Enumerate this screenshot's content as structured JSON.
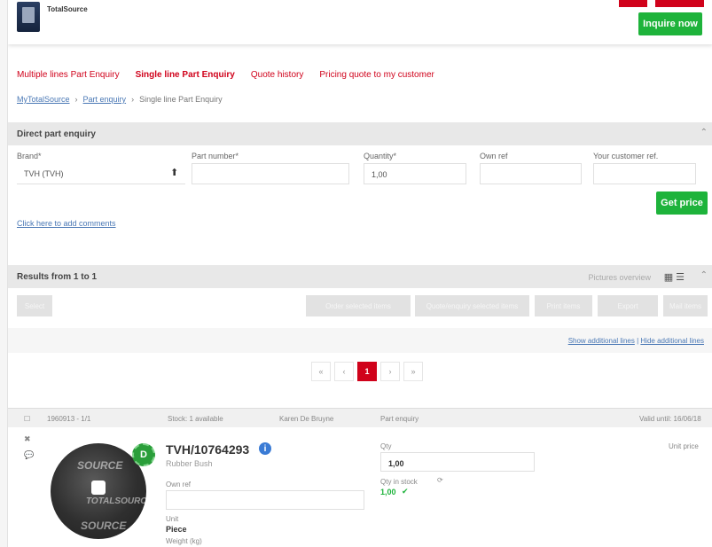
{
  "header": {
    "logo_text": "TotalSource",
    "inquire_label": "Inquire now",
    "accent_red": "#d0021b",
    "accent_green": "#1eb33b"
  },
  "nav": {
    "tabs": [
      {
        "label": "Multiple lines Part Enquiry"
      },
      {
        "label": "Single line Part Enquiry"
      },
      {
        "label": "Quote history"
      },
      {
        "label": "Pricing quote to my customer"
      }
    ]
  },
  "breadcrumb": {
    "items": [
      "MyTotalSource",
      "Part enquiry",
      "Single line Part Enquiry"
    ],
    "separator": "›"
  },
  "direct_enquiry": {
    "title": "Direct part enquiry",
    "brand_label": "Brand*",
    "brand_value": "TVH (TVH)",
    "part_label": "Part number*",
    "part_value": "",
    "qty_label": "Quantity*",
    "qty_value": "1,00",
    "ref_label": "Own ref",
    "ref_value": "",
    "customer_ref_label": "Your customer ref.",
    "customer_ref_value": "",
    "get_price_label": "Get price",
    "comment_link": "Click here to add comments"
  },
  "results": {
    "title": "Results from 1 to 1",
    "view_label": "Pictures overview",
    "select_btn": "Select",
    "toolbar": [
      "Order selected items",
      "Quote/enquiry selected items",
      "Print items",
      "Export",
      "Mail items"
    ],
    "show_additional": "Show additional lines",
    "hide_additional": "Hide additional lines",
    "link_separator": " | ",
    "pager": {
      "first": "«",
      "prev": "‹",
      "current": "1",
      "next": "›",
      "last": "»"
    }
  },
  "item": {
    "line_id": "1960913 - 1/1",
    "stock_info": "Stock: 1 available",
    "owner": "Karen De Bruyne",
    "part_enquiry": "Part enquiry",
    "date_label": "Valid until: 16/06/18",
    "part_number": "TVH/10764293",
    "description": "Rubber Bush",
    "badge": "D",
    "watermark_1": "SOURCE",
    "watermark_2": "TOTALSOURCE",
    "watermark_3": "SOURCE",
    "own_ref_label": "Own ref",
    "unit_label": "Unit",
    "unit_value": "Piece",
    "weight_label": "Weight (kg)",
    "qty_label": "Qty",
    "qty_value": "1,00",
    "stock_label": "Qty in stock",
    "stock_value": "1,00",
    "unit_price_label": "Unit price"
  }
}
